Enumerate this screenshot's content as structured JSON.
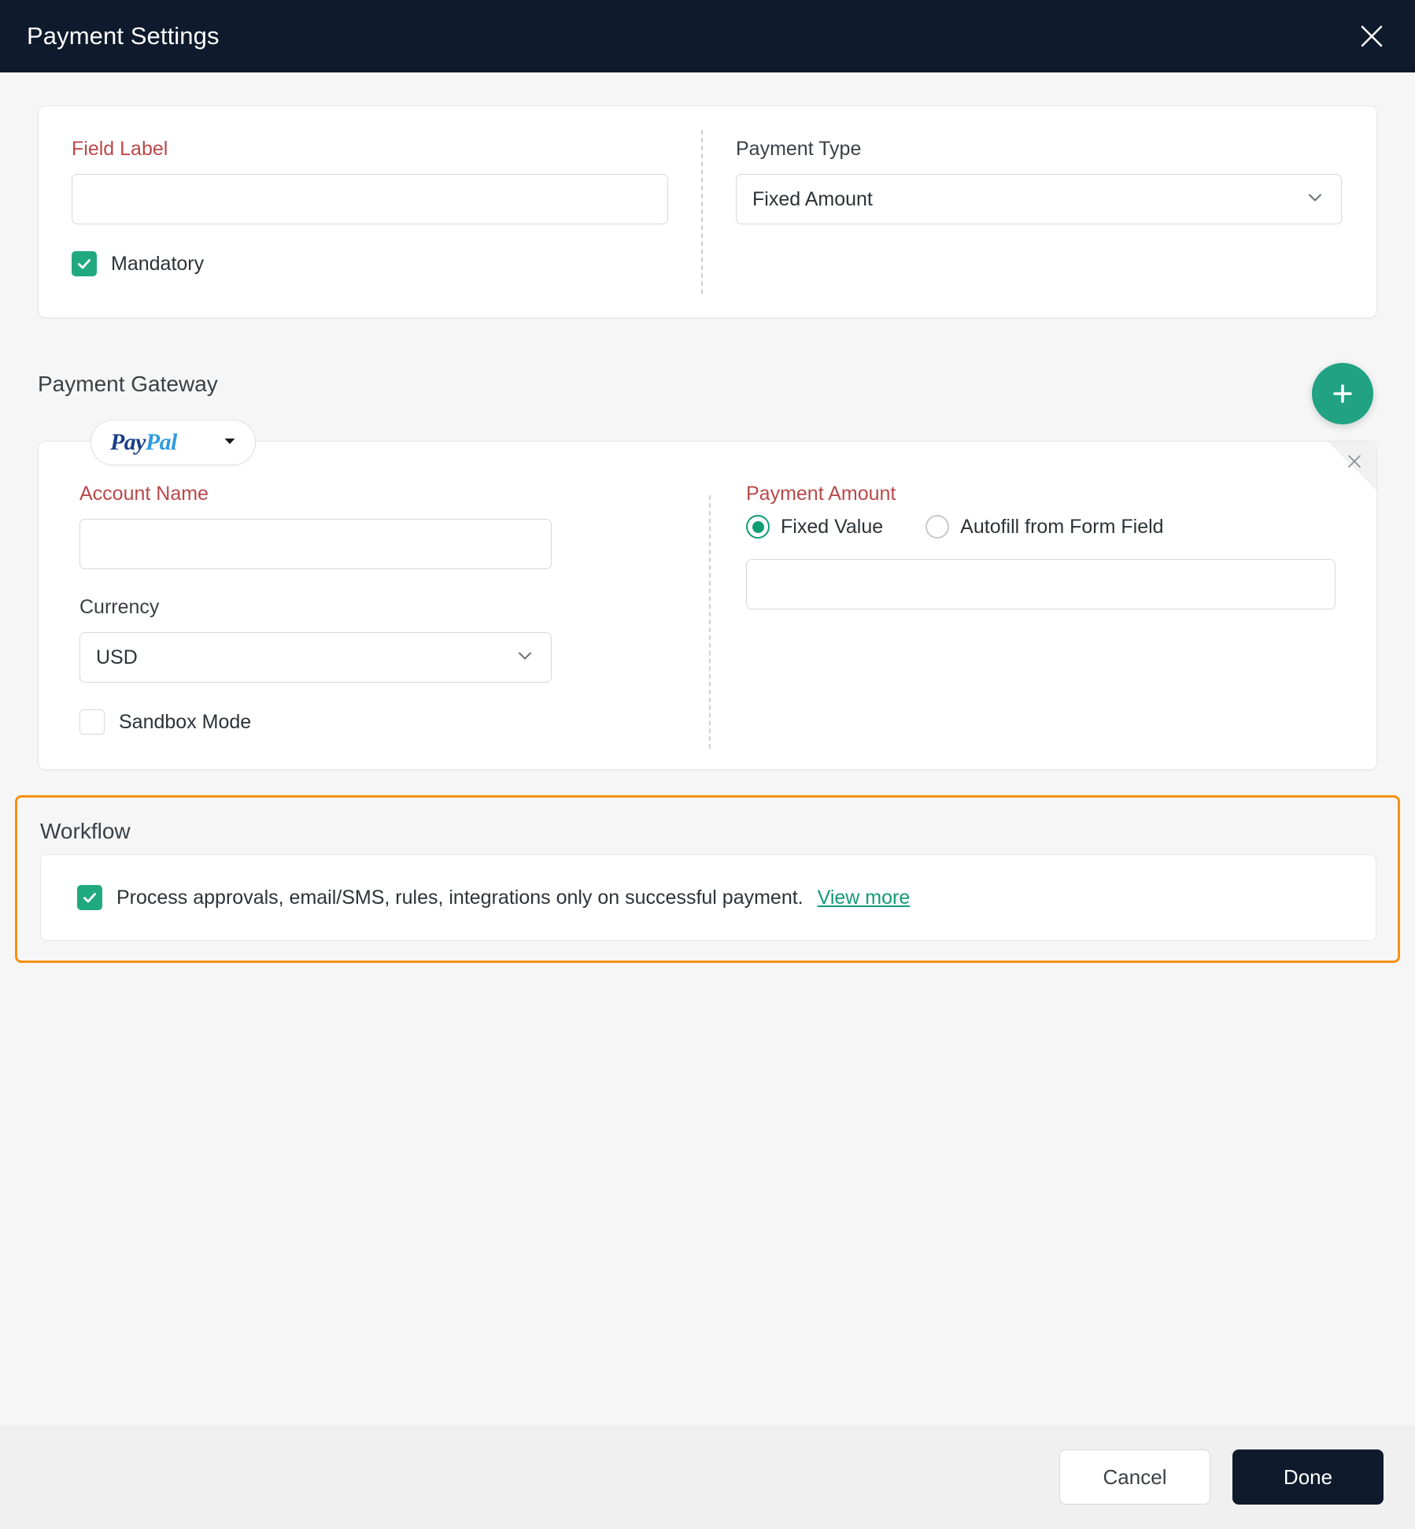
{
  "header": {
    "title": "Payment Settings",
    "close_icon": "close-icon"
  },
  "field_section": {
    "field_label": {
      "label": "Field Label",
      "required": true,
      "value": "",
      "placeholder": ""
    },
    "mandatory": {
      "label": "Mandatory",
      "checked": true
    },
    "payment_type": {
      "label": "Payment Type",
      "value": "Fixed Amount",
      "chevron_icon": "chevron-down-icon"
    }
  },
  "gateway_section": {
    "heading": "Payment Gateway",
    "add_button": {
      "icon": "plus-icon",
      "aria": "Add payment gateway"
    },
    "tab": {
      "name_part1": "Pay",
      "name_part2": "Pal",
      "caret_icon": "caret-down-icon"
    },
    "remove_icon": "close-icon",
    "account_name": {
      "label": "Account Name",
      "required": true,
      "value": "",
      "placeholder": ""
    },
    "currency": {
      "label": "Currency",
      "value": "USD",
      "chevron_icon": "chevron-down-icon"
    },
    "sandbox_mode": {
      "label": "Sandbox Mode",
      "checked": false
    },
    "payment_amount": {
      "label": "Payment Amount",
      "required": true,
      "option_fixed": "Fixed Value",
      "option_autofill": "Autofill from Form Field",
      "selected": "Fixed Value",
      "value": "",
      "placeholder": ""
    }
  },
  "workflow_section": {
    "title": "Workflow",
    "checkbox": {
      "checked": true,
      "text": "Process approvals, email/SMS, rules, integrations only on successful payment.",
      "link": "View more"
    }
  },
  "footer": {
    "cancel_label": "Cancel",
    "done_label": "Done"
  },
  "colors": {
    "header_bg": "#101a2d",
    "accent_green": "#20a97f",
    "accent_teal": "#149a79",
    "required_red": "#b9484a",
    "highlight_orange": "#f59110",
    "paypal_dark": "#1b3f87",
    "paypal_light": "#2f9bdc",
    "page_bg": "#f6f6f7",
    "footer_bg": "#f0f0f1"
  }
}
